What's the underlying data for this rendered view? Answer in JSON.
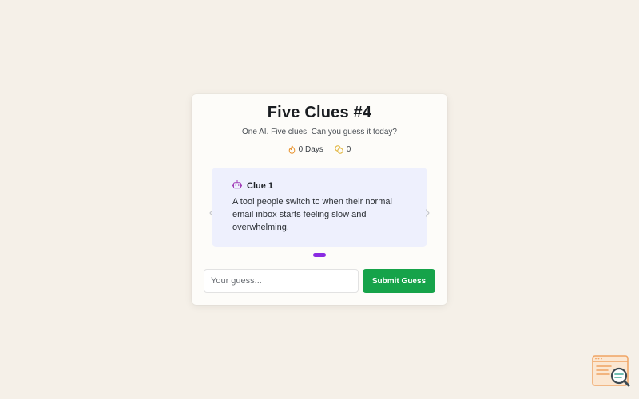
{
  "game": {
    "title": "Five Clues #4",
    "subtitle": "One AI. Five clues. Can you guess it today?"
  },
  "stats": {
    "streak_icon": "flame-icon",
    "streak_label": "0 Days",
    "coins_icon": "coins-icon",
    "coins_value": "0"
  },
  "clue": {
    "icon": "robot-icon",
    "label": "Clue 1",
    "text": "A tool people switch to when their normal email inbox starts feeling slow and overwhelming.",
    "current_index": 1,
    "total_visible_dots": 1
  },
  "guess": {
    "placeholder": "Your guess...",
    "value": "",
    "submit_label": "Submit Guess"
  },
  "colors": {
    "background": "#f5f0e8",
    "card": "#fdfcf9",
    "clue_box": "#eef0fd",
    "accent_purple": "#8a2be2",
    "submit_green": "#16a34a",
    "flame_orange": "#e8922c",
    "coin_gold": "#e0b234"
  },
  "corner_widget": {
    "icon": "browser-search-icon"
  }
}
